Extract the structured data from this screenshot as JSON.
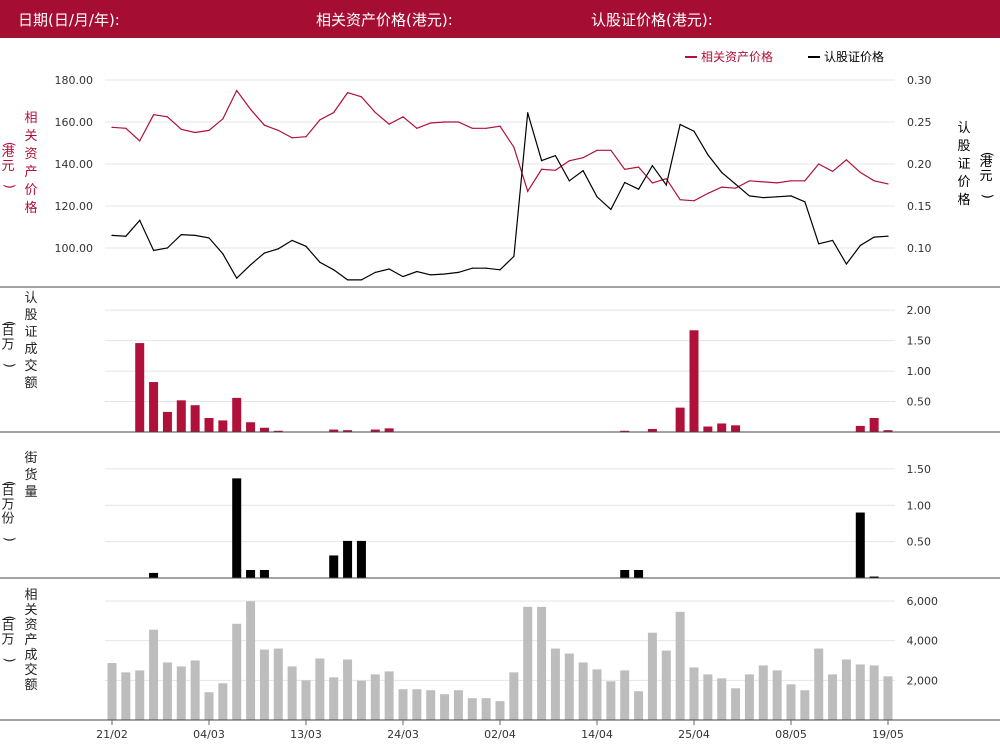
{
  "header": {
    "date_label": "日期(日/月/年):",
    "asset_price_label": "相关资产价格(港元):",
    "warrant_price_label": "认股证价格(港元):"
  },
  "colors": {
    "brand": "#a50e32",
    "asset_line": "#b0103a",
    "warrant_line": "#000000",
    "warrant_turnover_bar": "#b0103a",
    "outstanding_bar": "#000000",
    "asset_turnover_bar": "#bdbdbd"
  },
  "chart_data": [
    {
      "type": "line",
      "legend_placement": "top-right",
      "grid": true,
      "y_left_label": "相关资产价格 (港元)",
      "y_right_label": "认股证价格 (港元)",
      "y_left_ticks": [
        "100.00",
        "120.00",
        "140.00",
        "160.00",
        "180.00"
      ],
      "y_right_ticks": [
        "0.10",
        "0.15",
        "0.20",
        "0.25",
        "0.30"
      ],
      "ylim_left": [
        88,
        182
      ],
      "ylim_right": [
        0.062,
        0.302
      ],
      "series": [
        {
          "name": "相关资产价格",
          "axis": "left",
          "values": [
            157.5,
            157,
            151,
            163.5,
            162.5,
            156.5,
            155,
            156,
            161.5,
            175,
            166,
            158.5,
            156,
            152.5,
            153,
            161,
            164.5,
            174,
            172,
            164.5,
            159,
            162.5,
            157,
            159.5,
            160,
            160,
            157,
            157,
            158,
            148,
            127,
            137.5,
            137,
            141.5,
            143,
            146.5,
            146.5,
            137.5,
            138.5,
            131,
            133,
            123,
            122.5,
            126,
            129,
            128.5,
            132,
            131.5,
            131,
            132,
            132,
            140,
            136.5,
            142,
            136,
            132,
            130.5
          ]
        },
        {
          "name": "认股证价格",
          "axis": "right",
          "values": [
            0.115,
            0.114,
            0.133,
            0.097,
            0.1,
            0.116,
            0.115,
            0.112,
            0.093,
            0.064,
            0.08,
            0.094,
            0.099,
            0.109,
            0.102,
            0.083,
            0.074,
            0.062,
            0.062,
            0.071,
            0.075,
            0.066,
            0.072,
            0.068,
            0.069,
            0.071,
            0.076,
            0.076,
            0.074,
            0.09,
            0.261,
            0.204,
            0.21,
            0.18,
            0.192,
            0.161,
            0.146,
            0.178,
            0.17,
            0.198,
            0.175,
            0.247,
            0.239,
            0.211,
            0.19,
            0.176,
            0.162,
            0.16,
            0.161,
            0.162,
            0.155,
            0.105,
            0.109,
            0.081,
            0.103,
            0.113,
            0.114
          ]
        }
      ]
    },
    {
      "type": "bar",
      "grid": true,
      "ylabel": "认股证成交额 (百万)",
      "y_ticks": [
        "0.50",
        "1.00",
        "1.50",
        "2.00"
      ],
      "ylim": [
        0,
        2.2
      ],
      "values": [
        0,
        0,
        1.46,
        0.82,
        0.33,
        0.52,
        0.44,
        0.23,
        0.19,
        0.56,
        0.16,
        0.07,
        0.02,
        0,
        0,
        0,
        0.04,
        0.03,
        0,
        0.04,
        0.06,
        0,
        0,
        0,
        0,
        0,
        0,
        0,
        0,
        0,
        0,
        0,
        0,
        0,
        0,
        0,
        0,
        0.02,
        0,
        0.05,
        0,
        0.4,
        1.67,
        0.09,
        0.14,
        0.11,
        0,
        0,
        0,
        0,
        0,
        0,
        0,
        0,
        0.1,
        0.23,
        0.03
      ]
    },
    {
      "type": "bar",
      "grid": true,
      "ylabel": "街货量 (百万份)",
      "y_ticks": [
        "0.50",
        "1.00",
        "1.50"
      ],
      "ylim": [
        0,
        1.65
      ],
      "values": [
        0,
        0,
        0,
        0.07,
        0,
        0,
        0,
        0,
        0,
        1.37,
        0.11,
        0.11,
        0,
        0,
        0,
        0,
        0.31,
        0.51,
        0.51,
        0,
        0,
        0,
        0,
        0,
        0,
        0,
        0,
        0,
        0,
        0,
        0,
        0,
        0,
        0,
        0,
        0,
        0,
        0.11,
        0.11,
        0,
        0,
        0,
        0,
        0,
        0,
        0,
        0,
        0,
        0,
        0,
        0,
        0,
        0,
        0,
        0.9,
        0.02,
        0
      ]
    },
    {
      "type": "bar",
      "grid": true,
      "ylabel": "相关资产成交额 (百万)",
      "y_ticks": [
        "2,000",
        "4,000",
        "6,000"
      ],
      "ylim": [
        0,
        6300
      ],
      "x_tick_labels": [
        "21/02",
        "04/03",
        "13/03",
        "24/03",
        "02/04",
        "14/04",
        "25/04",
        "08/05",
        "19/05"
      ],
      "values": [
        2870,
        2400,
        2500,
        4550,
        2900,
        2700,
        3000,
        1400,
        1850,
        4850,
        5980,
        3550,
        3600,
        2700,
        2000,
        3100,
        2150,
        3050,
        1980,
        2300,
        2450,
        1550,
        1550,
        1500,
        1300,
        1500,
        1100,
        1100,
        950,
        2400,
        5700,
        5700,
        3600,
        3350,
        2900,
        2550,
        1950,
        2500,
        1450,
        4400,
        3500,
        5450,
        2650,
        2300,
        2100,
        1600,
        2300,
        2750,
        2500,
        1800,
        1500,
        3600,
        2300,
        3050,
        2800,
        2750,
        2200
      ]
    }
  ]
}
